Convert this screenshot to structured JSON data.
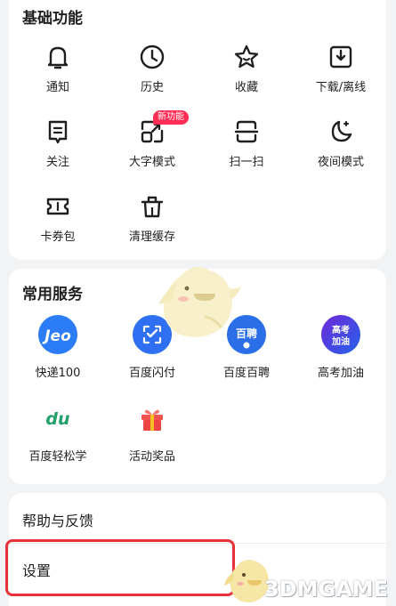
{
  "basic": {
    "title": "基础功能",
    "items": [
      {
        "label": "通知",
        "icon": "bell-icon"
      },
      {
        "label": "历史",
        "icon": "clock-icon"
      },
      {
        "label": "收藏",
        "icon": "star-icon"
      },
      {
        "label": "下载/离线",
        "icon": "download-icon"
      },
      {
        "label": "关注",
        "icon": "bookmark-list-icon"
      },
      {
        "label": "大字模式",
        "icon": "text-size-icon",
        "badge": "新功能"
      },
      {
        "label": "扫一扫",
        "icon": "scan-icon"
      },
      {
        "label": "夜间模式",
        "icon": "moon-icon"
      },
      {
        "label": "卡券包",
        "icon": "ticket-icon"
      },
      {
        "label": "清理缓存",
        "icon": "trash-icon"
      }
    ]
  },
  "services": {
    "title": "常用服务",
    "items": [
      {
        "label": "快递100",
        "icon": "kuaidi100-icon",
        "icon_text": "Jeo",
        "color": "#2b7cf6"
      },
      {
        "label": "百度闪付",
        "icon": "baidu-pay-icon",
        "color": "#2f6ff2"
      },
      {
        "label": "百度百聘",
        "icon": "baipin-icon",
        "icon_text": "百聘",
        "color": "#2a6ee8"
      },
      {
        "label": "高考加油",
        "icon": "gaokao-icon",
        "icon_text": "高考加油",
        "color": "#4338ca"
      },
      {
        "label": "百度轻松学",
        "icon": "qingsongxue-icon",
        "icon_text": "du",
        "color": "#22a06b"
      },
      {
        "label": "活动奖品",
        "icon": "gift-icon",
        "color": "#ef4444"
      }
    ]
  },
  "help": {
    "feedback_label": "帮助与反馈",
    "settings_label": "设置"
  },
  "watermark": {
    "text": "3DMGAME"
  },
  "colors": {
    "badge": "#ff2d55",
    "highlight": "#e8323a"
  }
}
